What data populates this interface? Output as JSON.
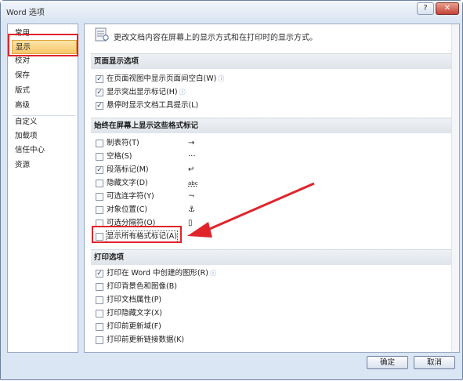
{
  "window": {
    "title": "Word 选项",
    "help": "?",
    "close": "✕"
  },
  "sidebar": {
    "items": [
      {
        "label": "常用"
      },
      {
        "label": "显示"
      },
      {
        "label": "校对"
      },
      {
        "label": "保存"
      },
      {
        "label": "版式"
      },
      {
        "label": "高级"
      },
      {
        "label": "自定义"
      },
      {
        "label": "加载项"
      },
      {
        "label": "信任中心"
      },
      {
        "label": "资源"
      }
    ],
    "selected": "显示"
  },
  "header": {
    "text": "更改文档内容在屏幕上的显示方式和在打印时的显示方式。"
  },
  "page_display": {
    "title": "页面显示选项",
    "items": [
      {
        "label": "在页面视图中显示页面间空白(W)",
        "checked": true,
        "info": "ⓘ"
      },
      {
        "label": "显示突出显示标记(H)",
        "checked": true,
        "info": "ⓘ"
      },
      {
        "label": "悬停时显示文档工具提示(L)",
        "checked": true
      }
    ]
  },
  "format_marks": {
    "title": "始终在屏幕上显示这些格式标记",
    "items": [
      {
        "label": "制表符(T)",
        "checked": false,
        "symbol": "→"
      },
      {
        "label": "空格(S)",
        "checked": false,
        "symbol": "···"
      },
      {
        "label": "段落标记(M)",
        "checked": true,
        "symbol": "↵"
      },
      {
        "label": "隐藏文字(D)",
        "checked": false,
        "symbol": "abc"
      },
      {
        "label": "可选连字符(Y)",
        "checked": false,
        "symbol": "¬"
      },
      {
        "label": "对象位置(C)",
        "checked": false,
        "symbol": "⚓"
      },
      {
        "label": "可选分隔符(O)",
        "checked": false,
        "symbol": "▯"
      },
      {
        "label": "显示所有格式标记(A)",
        "checked": false
      }
    ]
  },
  "print": {
    "title": "打印选项",
    "items": [
      {
        "label": "打印在 Word 中创建的图形(R)",
        "checked": true,
        "info": "ⓘ"
      },
      {
        "label": "打印背景色和图像(B)",
        "checked": false
      },
      {
        "label": "打印文档属性(P)",
        "checked": false
      },
      {
        "label": "打印隐藏文字(X)",
        "checked": false
      },
      {
        "label": "打印前更新域(F)",
        "checked": false
      },
      {
        "label": "打印前更新链接数据(K)",
        "checked": false
      }
    ]
  },
  "footer": {
    "ok": "确定",
    "cancel": "取消"
  },
  "colors": {
    "highlight": "#e0242b",
    "selection": "#f7c66b"
  }
}
